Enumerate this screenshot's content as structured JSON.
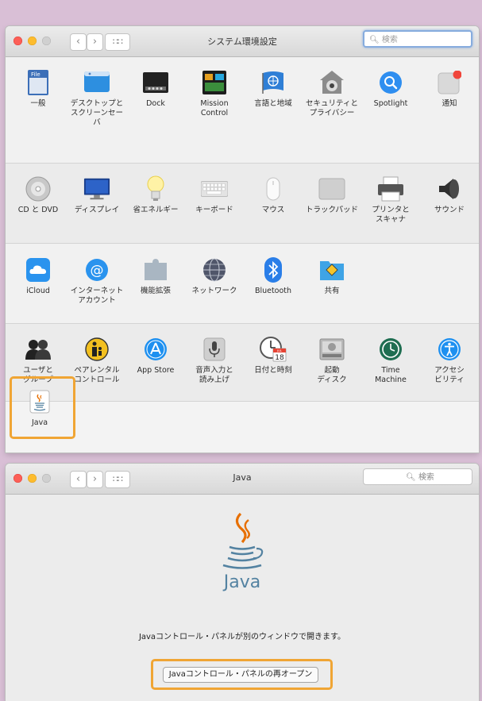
{
  "window1": {
    "title": "システム環境設定",
    "search_placeholder": "検索",
    "rows": [
      [
        {
          "label": "一般",
          "icon": "general-icon"
        },
        {
          "label": "デスクトップと\nスクリーンセーバ",
          "icon": "desktop-icon"
        },
        {
          "label": "Dock",
          "icon": "dock-icon"
        },
        {
          "label": "Mission\nControl",
          "icon": "mission-control-icon"
        },
        {
          "label": "言語と地域",
          "icon": "language-region-icon"
        },
        {
          "label": "セキュリティと\nプライバシー",
          "icon": "security-icon"
        },
        {
          "label": "Spotlight",
          "icon": "spotlight-icon"
        },
        {
          "label": "通知",
          "icon": "notifications-icon"
        }
      ],
      [
        {
          "label": "CD と DVD",
          "icon": "cd-dvd-icon"
        },
        {
          "label": "ディスプレイ",
          "icon": "display-icon"
        },
        {
          "label": "省エネルギー",
          "icon": "energy-saver-icon"
        },
        {
          "label": "キーボード",
          "icon": "keyboard-icon"
        },
        {
          "label": "マウス",
          "icon": "mouse-icon"
        },
        {
          "label": "トラックパッド",
          "icon": "trackpad-icon"
        },
        {
          "label": "プリンタと\nスキャナ",
          "icon": "printer-icon"
        },
        {
          "label": "サウンド",
          "icon": "sound-icon"
        }
      ],
      [
        {
          "label": "iCloud",
          "icon": "icloud-icon"
        },
        {
          "label": "インターネット\nアカウント",
          "icon": "internet-accounts-icon"
        },
        {
          "label": "機能拡張",
          "icon": "extensions-icon"
        },
        {
          "label": "ネットワーク",
          "icon": "network-icon"
        },
        {
          "label": "Bluetooth",
          "icon": "bluetooth-icon"
        },
        {
          "label": "共有",
          "icon": "sharing-icon"
        }
      ],
      [
        {
          "label": "ユーザと\nグループ",
          "icon": "users-groups-icon"
        },
        {
          "label": "ペアレンタル\nコントロール",
          "icon": "parental-controls-icon"
        },
        {
          "label": "App Store",
          "icon": "app-store-icon"
        },
        {
          "label": "音声入力と\n読み上げ",
          "icon": "dictation-icon"
        },
        {
          "label": "日付と時刻",
          "icon": "date-time-icon"
        },
        {
          "label": "起動\nディスク",
          "icon": "startup-disk-icon"
        },
        {
          "label": "Time\nMachine",
          "icon": "time-machine-icon"
        },
        {
          "label": "アクセシ\nビリティ",
          "icon": "accessibility-icon"
        }
      ],
      [
        {
          "label": "Java",
          "icon": "java-icon"
        }
      ]
    ],
    "calendar_day": "18",
    "calendar_month": "JUL"
  },
  "window2": {
    "title": "Java",
    "search_placeholder": "検索",
    "logo_text": "Java",
    "message": "Javaコントロール・パネルが別のウィンドウで開きます。",
    "reopen_button": "Javaコントロール・パネルの再オープン"
  },
  "colors": {
    "background": "#d9bfd6",
    "highlight": "#f0a534"
  }
}
